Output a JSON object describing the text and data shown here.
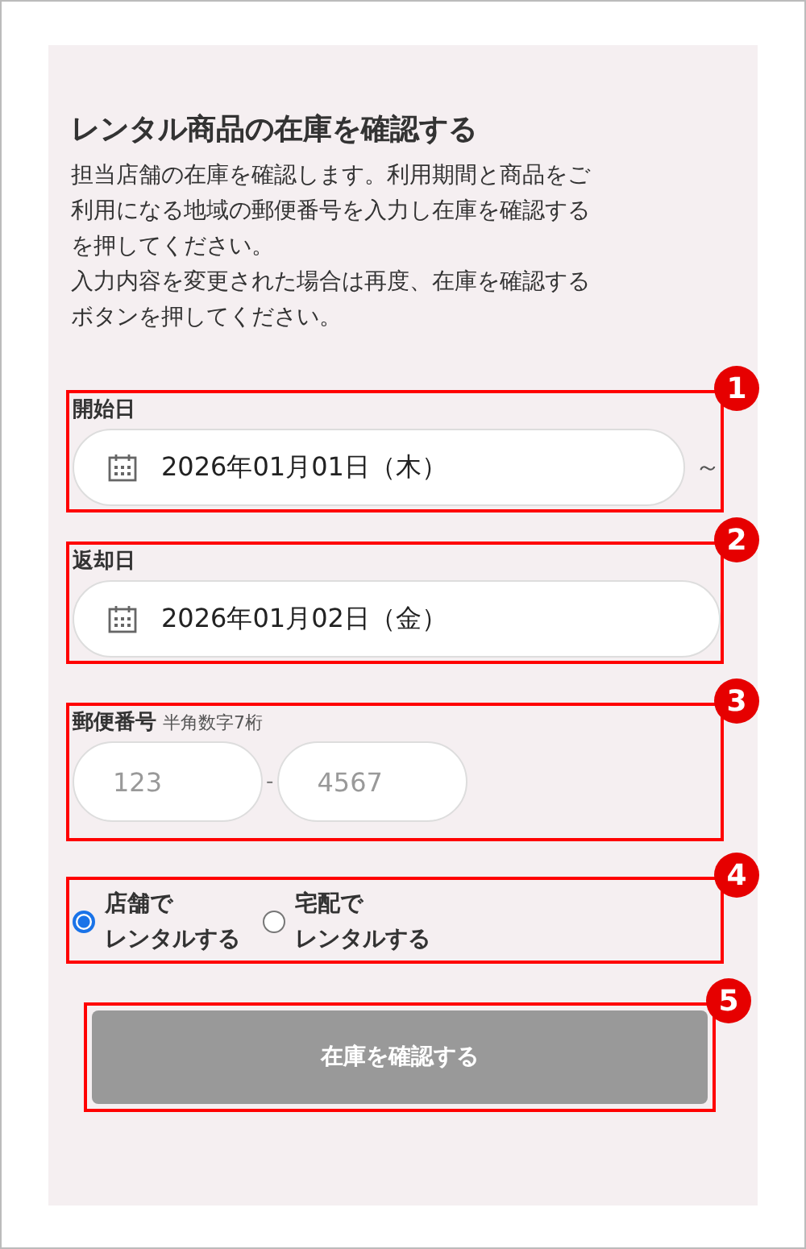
{
  "title": "レンタル商品の在庫を確認する",
  "description": [
    "担当店舗の在庫を確認します。利用期間と商品をご利用になる地域の郵便番号を入力し在庫を確認するを押してください。",
    "入力内容を変更された場合は再度、在庫を確認するボタンを押してください。"
  ],
  "start_date": {
    "label": "開始日",
    "value": "2026年01月01日（木）",
    "separator": "～",
    "callout": "1"
  },
  "return_date": {
    "label": "返却日",
    "value": "2026年01月02日（金）",
    "callout": "2"
  },
  "postal_code": {
    "label": "郵便番号",
    "hint": "半角数字7桁",
    "fields": [
      {
        "placeholder": "123"
      },
      {
        "placeholder": "4567"
      }
    ],
    "separator": "-",
    "callout": "3"
  },
  "rental_method": {
    "options": [
      {
        "label_lines": [
          "店舗で",
          "レンタルする"
        ],
        "selected": true
      },
      {
        "label_lines": [
          "宅配で",
          "レンタルする"
        ],
        "selected": false
      }
    ],
    "callout": "4"
  },
  "submit": {
    "label": "在庫を確認する",
    "disabled": true,
    "callout": "5"
  }
}
